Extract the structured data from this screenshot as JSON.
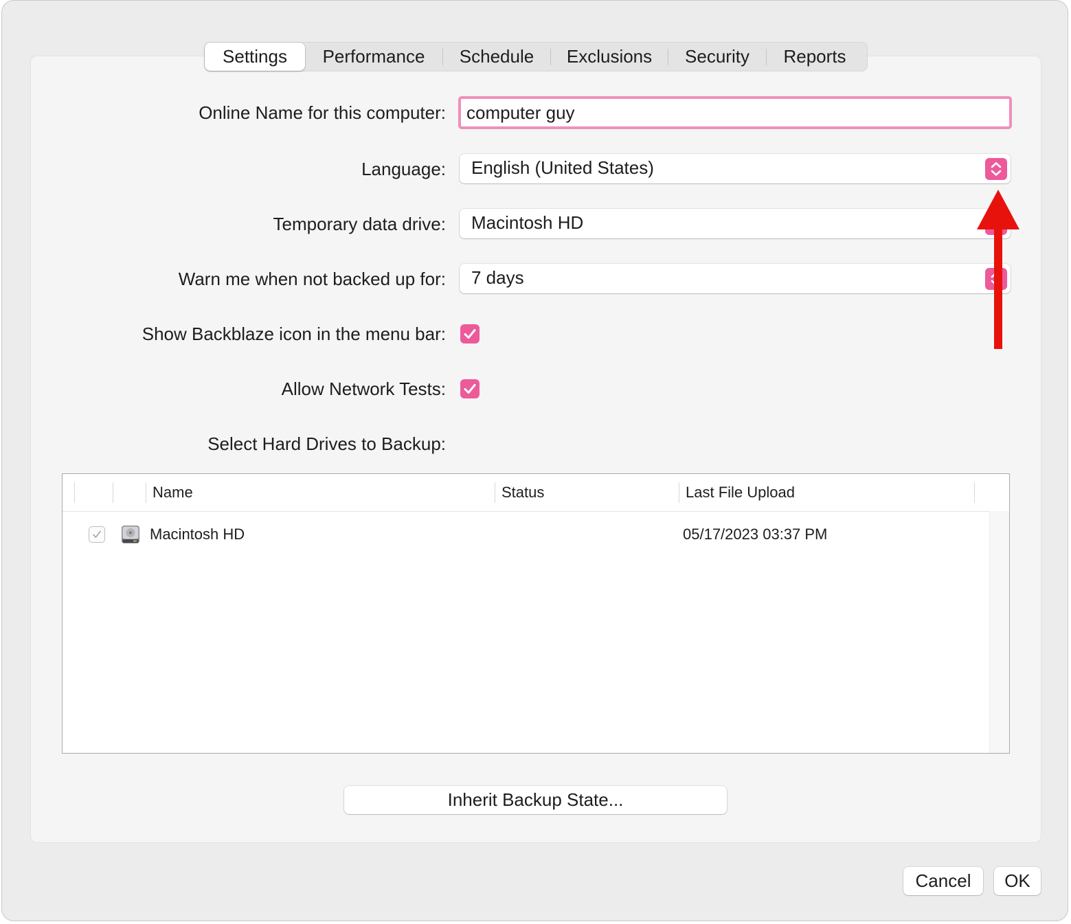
{
  "tabs": [
    {
      "label": "Settings",
      "active": true
    },
    {
      "label": "Performance",
      "active": false
    },
    {
      "label": "Schedule",
      "active": false
    },
    {
      "label": "Exclusions",
      "active": false
    },
    {
      "label": "Security",
      "active": false
    },
    {
      "label": "Reports",
      "active": false
    }
  ],
  "settings": {
    "online_name": {
      "label": "Online Name for this computer:",
      "value": "computer guy"
    },
    "language": {
      "label": "Language:",
      "value": "English (United States)"
    },
    "temp_drive": {
      "label": "Temporary data drive:",
      "value": "Macintosh HD"
    },
    "warn": {
      "label": "Warn me when not backed up for:",
      "value": "7 days"
    },
    "show_icon": {
      "label": "Show Backblaze icon in the menu bar:",
      "checked": true
    },
    "network_tests": {
      "label": "Allow Network Tests:",
      "checked": true
    },
    "select_drives": {
      "label": "Select Hard Drives to Backup:"
    }
  },
  "drive_table": {
    "columns": {
      "name": "Name",
      "status": "Status",
      "last_upload": "Last File Upload"
    },
    "rows": [
      {
        "checked": true,
        "icon": "hard-drive-icon",
        "name": "Macintosh HD",
        "status": "",
        "last_upload": "05/17/2023 03:37 PM"
      }
    ]
  },
  "buttons": {
    "inherit": "Inherit Backup State...",
    "cancel": "Cancel",
    "ok": "OK"
  },
  "colors": {
    "accent": "#ec5a9a",
    "focus_ring": "#ef8fbb",
    "annotation_arrow": "#e8120c"
  }
}
